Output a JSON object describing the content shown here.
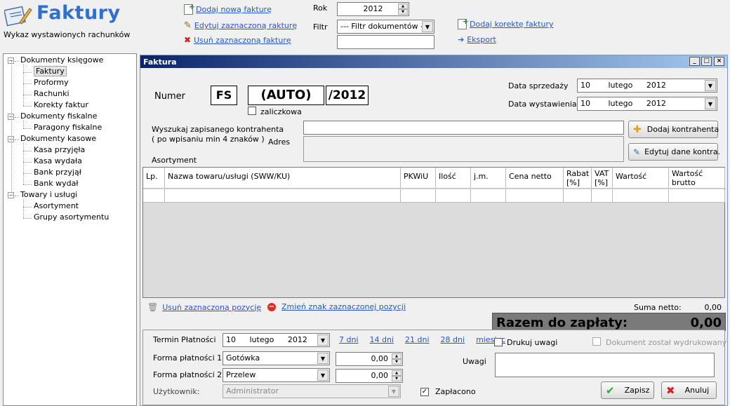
{
  "header": {
    "title": "Faktury",
    "subtitle": "Wykaz wystawionych rachunków",
    "actions": {
      "add": "Dodaj nową fakturę",
      "edit": "Edytuj zaznaczoną rakturę",
      "delete": "Usuń zaznaczoną fakturę",
      "add_correction": "Dodaj korektę faktury",
      "export": "Eksport"
    },
    "year_label": "Rok",
    "year_value": "2012",
    "filter_label": "Filtr",
    "filter_value": "--- Filtr dokumentów ---",
    "filter_text": ""
  },
  "tree": [
    {
      "label": "Dokumenty księgowe",
      "level": 0
    },
    {
      "label": "Faktury",
      "level": 1,
      "selected": true
    },
    {
      "label": "Proformy",
      "level": 1
    },
    {
      "label": "Rachunki",
      "level": 1
    },
    {
      "label": "Korekty faktur",
      "level": 1
    },
    {
      "label": "Dokumenty fiskalne",
      "level": 0
    },
    {
      "label": "Paragony fiskalne",
      "level": 1
    },
    {
      "label": "Dokumenty kasowe",
      "level": 0
    },
    {
      "label": "Kasa przyjęła",
      "level": 1
    },
    {
      "label": "Kasa wydała",
      "level": 1
    },
    {
      "label": "Bank przyjął",
      "level": 1
    },
    {
      "label": "Bank wydał",
      "level": 1
    },
    {
      "label": "Towary i usługi",
      "level": 0
    },
    {
      "label": "Asortyment",
      "level": 1
    },
    {
      "label": "Grupy asortymentu",
      "level": 1
    }
  ],
  "window": {
    "title": "Faktura",
    "btn_min": "_",
    "btn_max": "□",
    "btn_close": "×"
  },
  "invoice": {
    "number_label": "Numer",
    "prefix": "FS",
    "number": "(AUTO)",
    "suffix": "/2012",
    "advance_label": "zaliczkowa",
    "sale_date_label": "Data sprzedaży",
    "sale_date": {
      "day": "10",
      "month": "lutego",
      "year": "2012"
    },
    "issue_date_label": "Data wystawienia",
    "issue_date": {
      "day": "10",
      "month": "lutego",
      "year": "2012"
    },
    "search_label": "Wyszukaj zapisanego kontrahenta",
    "search_hint": "( po wpisaniu min 4 znaków )",
    "address_label": "Adres",
    "assortment_label": "Asortyment",
    "add_contractor": "Dodaj kontrahenta",
    "edit_contractor": "Edytuj dane kontra."
  },
  "table": {
    "columns": [
      "Lp.",
      "Nazwa towaru/usługi (SWW/KU)",
      "PKWiU",
      "Ilość",
      "j.m.",
      "Cena netto",
      "Rabat [%]",
      "VAT [%]",
      "Wartość netto",
      "Wartość brutto"
    ]
  },
  "row_actions": {
    "remove": "Usuń zaznaczoną pozycję",
    "flip_sign": "Zmień znak zaznaczonej pozycji"
  },
  "totals": {
    "net_label": "Suma netto:",
    "net_value": "0,00",
    "total_label": "Razem do zapłaty:",
    "total_value": "0,00"
  },
  "payment": {
    "term_label": "Termin Płatności",
    "term_date": {
      "day": "10",
      "month": "lutego",
      "year": "2012"
    },
    "quick_terms": [
      "7 dni",
      "14 dni",
      "21 dni",
      "28 dni",
      "miesiąc"
    ],
    "method1_label": "Forma płatności 1",
    "method1_value": "Gotówka",
    "method1_amount": "0,00",
    "method2_label": "Forma płatności 2",
    "method2_value": "Przelew",
    "method2_amount": "0,00",
    "user_label": "Użytkownik:",
    "user_value": "Administrator",
    "paid_label": "Zapłacono",
    "print_notes_label": "Drukuj uwagi",
    "printed_label": "Dokument został wydrukowany",
    "notes_label": "Uwagi",
    "save": "Zapisz",
    "cancel": "Anuluj"
  }
}
